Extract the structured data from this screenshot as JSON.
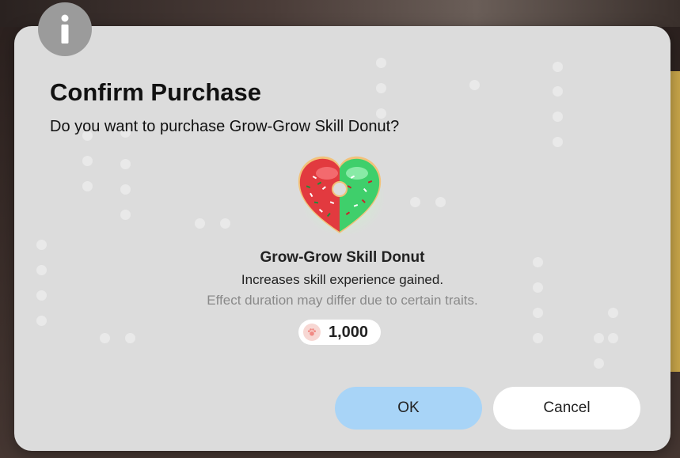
{
  "dialog": {
    "title": "Confirm Purchase",
    "question": "Do you want to purchase Grow-Grow Skill Donut?",
    "info_icon": "info-icon"
  },
  "item": {
    "name": "Grow-Grow Skill Donut",
    "description": "Increases skill experience gained.",
    "note": "Effect duration may differ due to certain traits.",
    "icon": "heart-donut-icon",
    "price": "1,000",
    "currency_icon": "paw-coin-icon"
  },
  "buttons": {
    "ok_label": "OK",
    "cancel_label": "Cancel"
  },
  "colors": {
    "dialog_bg": "#dcdcdc",
    "ok_button": "#a8d4f7",
    "cancel_button": "#ffffff",
    "info_circle": "#9b9b9b",
    "donut_red": "#e23a3f",
    "donut_green": "#3fcf6b"
  }
}
